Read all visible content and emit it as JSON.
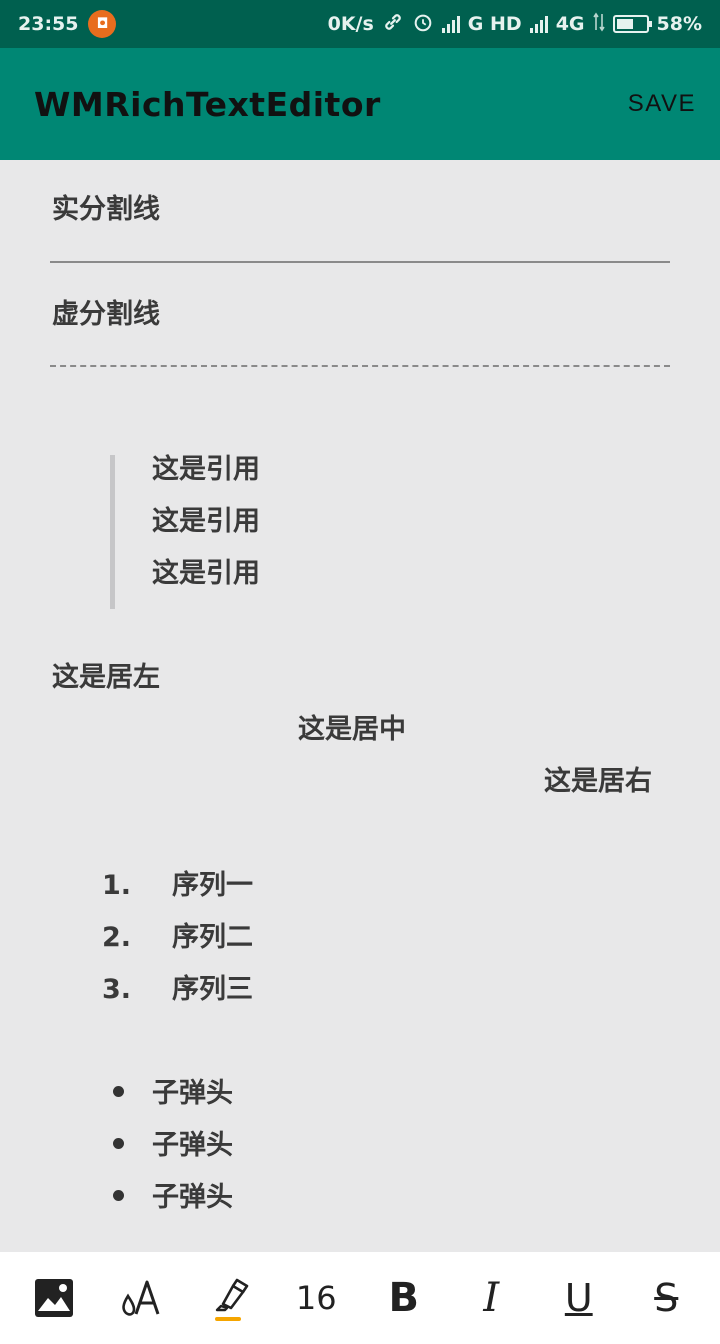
{
  "status_bar": {
    "time": "23:55",
    "notif_glyph": "◘",
    "net_speed": "0K/s",
    "network_1": "G HD",
    "network_2": "4G",
    "battery": "58%",
    "battery_level": 0.58
  },
  "app_bar": {
    "title": "WMRichTextEditor",
    "save_label": "SAVE"
  },
  "editor": {
    "solid_divider_label": "实分割线",
    "dashed_divider_label": "虚分割线",
    "quote_lines": [
      "这是引用",
      "这是引用",
      "这是引用"
    ],
    "align_left": "这是居左",
    "align_center": "这是居中",
    "align_right": "这是居右",
    "ordered_list": [
      {
        "num": "1.",
        "text": "序列一"
      },
      {
        "num": "2.",
        "text": "序列二"
      },
      {
        "num": "3.",
        "text": "序列三"
      }
    ],
    "bullet_list": [
      "子弹头",
      "子弹头",
      "子弹头"
    ]
  },
  "toolbar": {
    "items": [
      {
        "icon": "image-icon"
      },
      {
        "icon": "text-color-icon",
        "label": "A"
      },
      {
        "icon": "highlighter-icon",
        "accent": "#f5a500"
      },
      {
        "icon": "font-size-icon",
        "label": "16"
      },
      {
        "icon": "bold-icon",
        "label": "B"
      },
      {
        "icon": "italic-icon",
        "label": "I"
      },
      {
        "icon": "underline-icon",
        "label": "U"
      },
      {
        "icon": "strikethrough-icon",
        "label": "S"
      }
    ]
  },
  "colors": {
    "status_bar": "#00604f",
    "app_bar": "#008774",
    "editor_bg": "#e8e8e9",
    "toolbar_bg": "#ffffff"
  }
}
